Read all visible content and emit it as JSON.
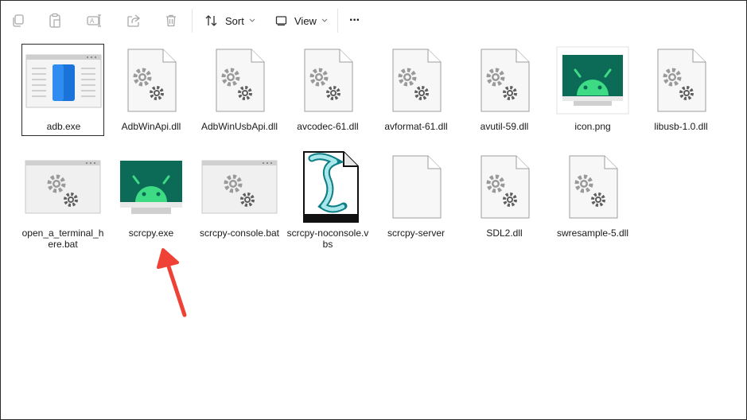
{
  "toolbar": {
    "copy_icon": "copy-icon",
    "paste_icon": "paste-icon",
    "rename_icon": "rename-icon",
    "share_icon": "share-icon",
    "delete_icon": "delete-icon",
    "sort_label": "Sort",
    "view_label": "View",
    "more_label": "···"
  },
  "files": [
    {
      "name": "adb.exe",
      "icon": "exe-window-icon"
    },
    {
      "name": "AdbWinApi.dll",
      "icon": "dll-gear-icon"
    },
    {
      "name": "AdbWinUsbApi.dll",
      "icon": "dll-gear-icon"
    },
    {
      "name": "avcodec-61.dll",
      "icon": "dll-gear-icon"
    },
    {
      "name": "avformat-61.dll",
      "icon": "dll-gear-icon"
    },
    {
      "name": "avutil-59.dll",
      "icon": "dll-gear-icon"
    },
    {
      "name": "icon.png",
      "icon": "android-png-icon"
    },
    {
      "name": "libusb-1.0.dll",
      "icon": "dll-gear-icon"
    },
    {
      "name": "open_a_terminal_here.bat",
      "icon": "bat-window-gear-icon"
    },
    {
      "name": "scrcpy.exe",
      "icon": "android-exe-icon"
    },
    {
      "name": "scrcpy-console.bat",
      "icon": "bat-window-gear-icon"
    },
    {
      "name": "scrcpy-noconsole.vbs",
      "icon": "vbs-script-icon"
    },
    {
      "name": "scrcpy-server",
      "icon": "blank-file-icon"
    },
    {
      "name": "SDL2.dll",
      "icon": "dll-gear-icon"
    },
    {
      "name": "swresample-5.dll",
      "icon": "dll-gear-icon"
    }
  ],
  "colors": {
    "arrow": "#ef4135",
    "android_green": "#3ddc84",
    "android_bg": "#0b6b57",
    "selection_border": "#2b2b2b"
  }
}
